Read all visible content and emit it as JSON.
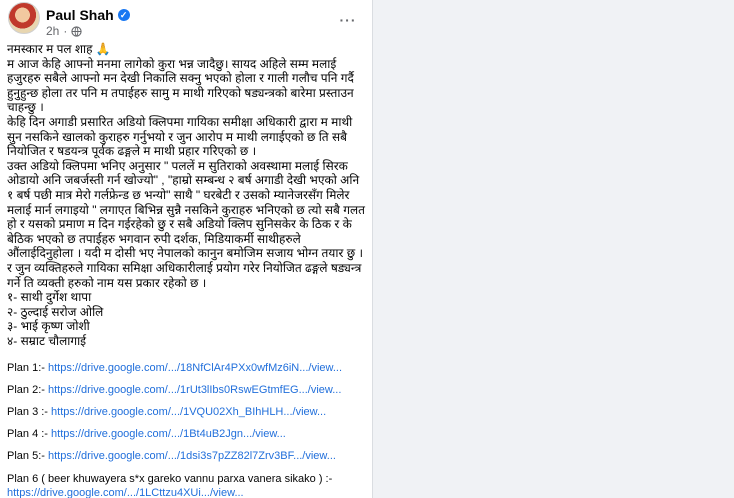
{
  "post": {
    "author": "Paul Shah",
    "time": "2h",
    "more_label": "···",
    "icons": {
      "verified": "verified-badge-icon",
      "audience": "globe-icon",
      "more": "more-options-icon"
    },
    "colors": {
      "link": "#216fdb",
      "verified": "#1877f2",
      "meta": "#65676b"
    },
    "paragraphs": [
      "नमस्कार म पल शाह 🙏",
      "म आज केहि आफ्नो मनमा लागेको कुरा भन्न जादैछु। सायद अहिले सम्म मलाई हजुरहरु सबैले आफ्नो मन देखी निकालि सक्नु भएको होला र गाली गलौच पनि गर्दै हुनुहुन्छ होला तर पनि म तपाईहरु सामु म माथी गरिएको षड्यन्त्रको बारेमा प्रस्ताउन चाहन्छु ।",
      "केहि दिन अगाडी प्रसारित अडियो क्लिपमा गायिका समीक्षा अधिकारी द्वारा म माथी सुन नसकिने खालको कुराहरु गर्नुभयो र जुन आरोप म माथी लगाईएको छ ति सबै नियोजित र षडयन्त्र पूर्वक ढङ्गले म माथी प्रहार गरिएको छ ।",
      "उक्त अडियो क्लिपमा भनिए अनुसार \" पललें म सुतिराको अवस्थामा मलाई सिरक ओडायो अनि जबर्जस्ती गर्न खोज्यो\" , \"हाम्रो सम्बन्ध २ बर्ष अगाडी देखी भएको अनि १ बर्ष पछी मात्र मेरो गर्लफ्रेन्ड छ भन्यो\" साथै \" घरबेटी र उसको म्यानेजरसँग मिलेर मलाई मार्न लगाइयो \" लगाएत बिभिन्न सुन्नै नसकिने कुराहरु भनिएको छ त्यो सबै गलत हो र यसको प्रमाण म दिन गईरहेको छु र सबै अडियो क्लिप सुनिसकेर के ठिक र के बेठिक भएको छ तपाईहरु भगवान रुपी दर्शक, मिडियाकर्मी साथीहरुले औंलाईदिनुहोला । यदी म दोसी भए नेपालको कानुन बमोजिम सजाय भोग्न तयार छु । र जुन व्यक्तिहरुले गायिका समिक्षा अधिकारीलाई प्रयोग गरेर नियोजित ढङ्गले षड्यन्त्र गर्ने ति व्यक्ती हरुको नाम यस प्रकार रहेको छ ।"
    ],
    "names": [
      "१- साथी दुर्गेश थापा",
      "२- ठुल्दाई सरोज ओलि",
      "३- भाई कृष्ण जोशी",
      "४- सम्राट चौलागाई"
    ],
    "plans": [
      {
        "prefix": "Plan 1:- ",
        "link": "https://drive.google.com/.../18NfClAr4PXx0wfMz6iN.../view..."
      },
      {
        "prefix": "Plan 2:- ",
        "link": "https://drive.google.com/.../1rUt3lIbs0RswEGtmfEG.../view..."
      },
      {
        "prefix": "Plan 3 :- ",
        "link": "https://drive.google.com/.../1VQU02Xh_BIhHLH.../view..."
      },
      {
        "prefix": "Plan 4 :- ",
        "link": "https://drive.google.com/.../1Bt4uB2Jgn.../view..."
      },
      {
        "prefix": "Plan 5:- ",
        "link": "https://drive.google.com/.../1dsi3s7pZZ82l7Zrv3BF.../view..."
      }
    ],
    "plan6": {
      "label": "Plan 6 ( beer khuwayera s*x gareko vannu parxa vanera sikako ) :-",
      "link": "https://drive.google.com/.../1LCttzu4XUi.../view..."
    }
  }
}
